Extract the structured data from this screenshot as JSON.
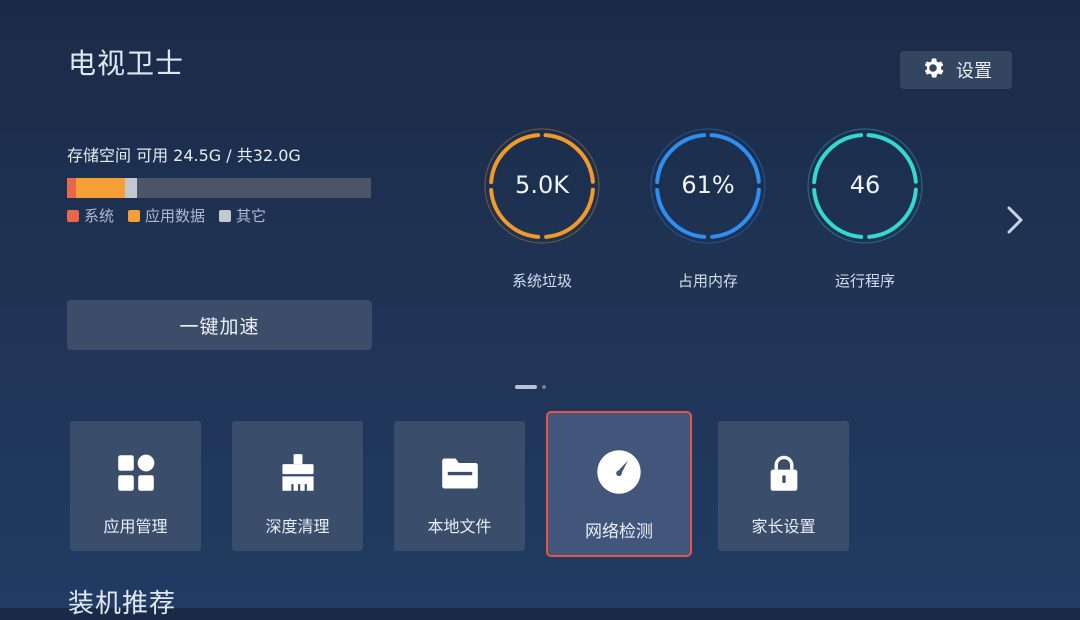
{
  "app": {
    "title": "电视卫士"
  },
  "settings": {
    "label": "设置",
    "icon": "gear-icon"
  },
  "storage": {
    "label": "存储空间 可用 24.5G / 共32.0G",
    "segments": [
      {
        "name": "系统",
        "fraction": 0.03,
        "color": "#e8664a"
      },
      {
        "name": "应用数据",
        "fraction": 0.16,
        "color": "#f5a037"
      },
      {
        "name": "其它",
        "fraction": 0.04,
        "color": "#c3c7cf"
      }
    ],
    "track_color": "#4c5568"
  },
  "stats": [
    {
      "value": "5.0K",
      "label": "系统垃圾",
      "color": "#f19a2a"
    },
    {
      "value": "61%",
      "label": "占用内存",
      "color": "#2f8ef0"
    },
    {
      "value": "46",
      "label": "运行程序",
      "color": "#34d8d0"
    }
  ],
  "boost": {
    "label": "一键加速"
  },
  "pager": {
    "count": 2,
    "active": 0
  },
  "tools": [
    {
      "label": "应用管理",
      "icon": "app-grid-icon"
    },
    {
      "label": "深度清理",
      "icon": "brush-icon"
    },
    {
      "label": "本地文件",
      "icon": "folder-icon"
    },
    {
      "label": "网络检测",
      "icon": "speedometer-icon",
      "selected": true
    },
    {
      "label": "家长设置",
      "icon": "lock-icon"
    }
  ],
  "recommend": {
    "title": "装机推荐"
  },
  "colors": {
    "focus_border": "#e5534b",
    "tile_bg": "#3a4e6c"
  }
}
